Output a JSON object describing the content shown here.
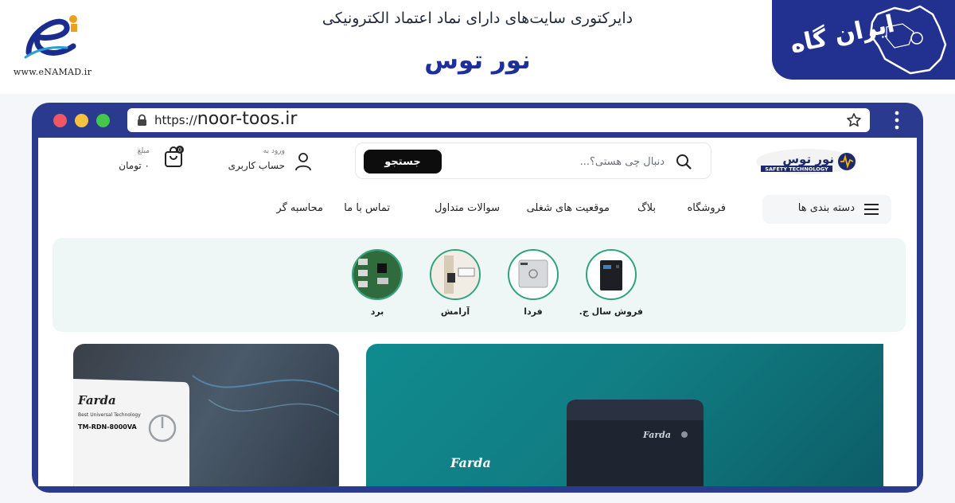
{
  "banner": {
    "enamad_url": "www.eNAMAD.ir",
    "title": "دایرکتوری سایت‌های دارای نماد اعتماد الکترونیکی",
    "site_name": "نور توس",
    "irangah_label": "ایران گاه"
  },
  "browser": {
    "url_protocol": "https://",
    "url_domain": "noor-toos.ir"
  },
  "header": {
    "logo_text": "نور توس",
    "logo_subtext": "SAFETY TECHNOLOGY",
    "search_placeholder": "دنبال چی هستی؟...",
    "search_button": "جستجو",
    "account_sub": "ورود به",
    "account_label": "حساب کاربری",
    "cart_sub": "مبلغ",
    "cart_total": "۰ تومان",
    "cart_count": "0"
  },
  "nav": {
    "categories_label": "دسته بندی ها",
    "links": [
      "فروشگاه",
      "بلاگ",
      "موقعیت های شغلی",
      "سوالات متداول",
      "تماس با ما",
      "محاسبه گر"
    ]
  },
  "categories": [
    {
      "label": "فروش سال ج..."
    },
    {
      "label": "فردا"
    },
    {
      "label": "آرامش"
    },
    {
      "label": "برد"
    }
  ],
  "promos": {
    "left_brand": "Farda",
    "left_model": "TM-RDN-8000VA",
    "left_tech": "Best Universal Technology",
    "right_brand": "Farda",
    "right_device_brand": "Farda"
  },
  "colors": {
    "brand_blue": "#22318f",
    "accent_green": "#2ea47d",
    "promo_teal": "#0f8b8e"
  }
}
